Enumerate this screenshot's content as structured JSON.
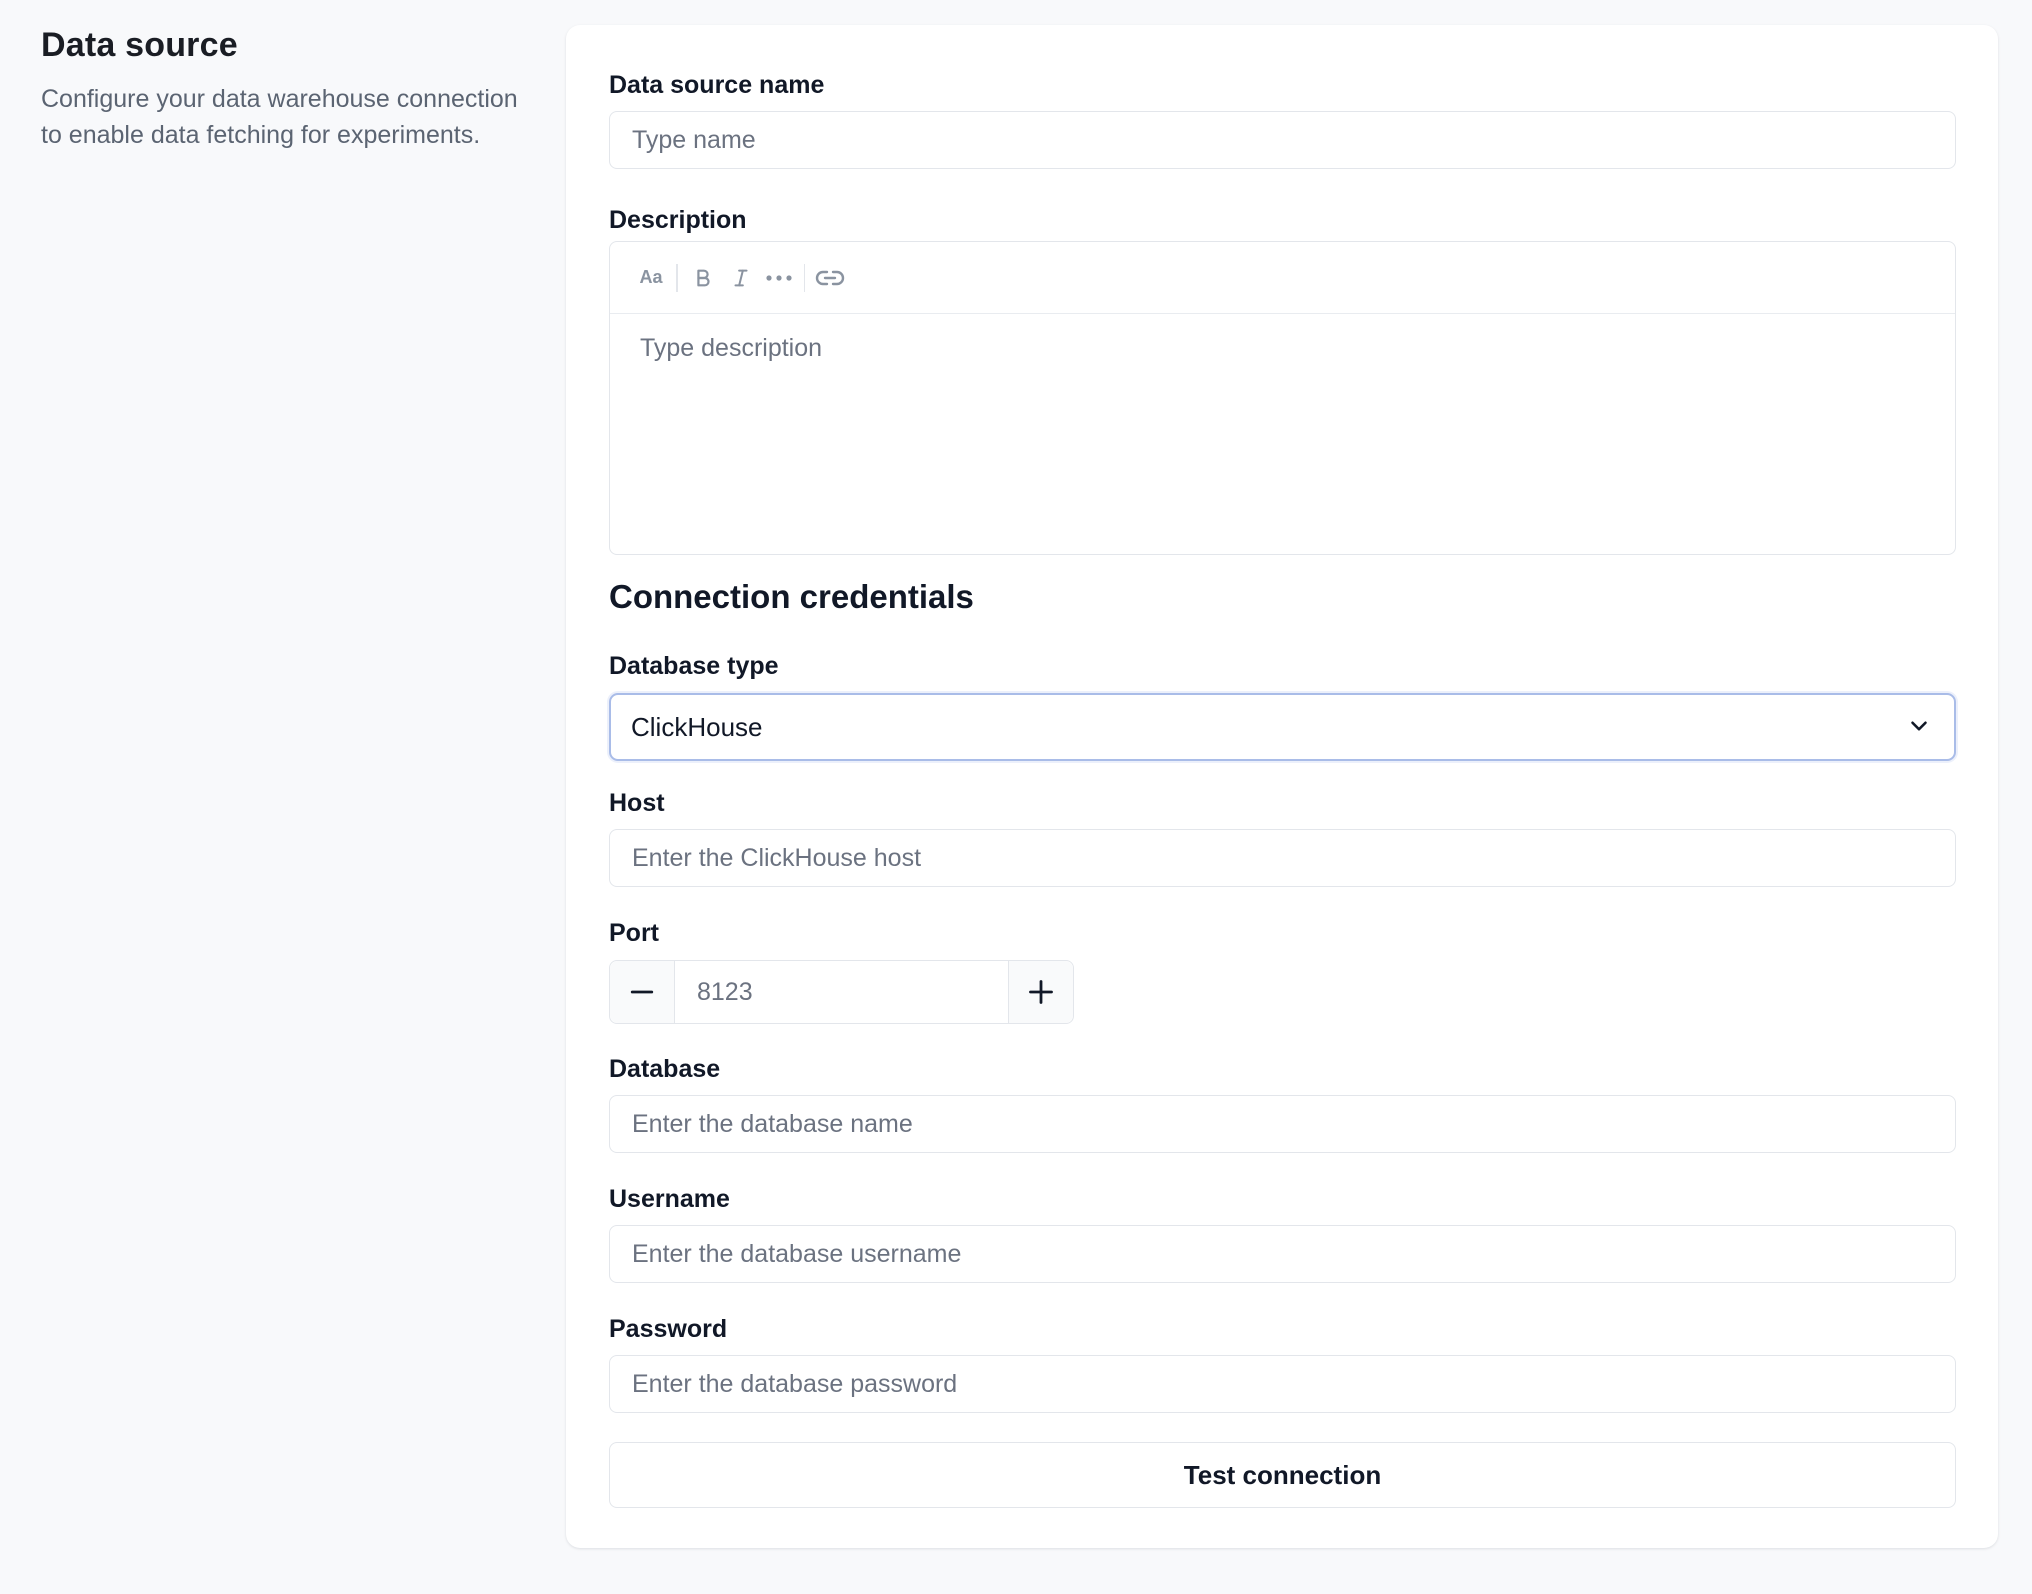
{
  "intro": {
    "title": "Data source",
    "description": "Configure your data warehouse connection to enable data fetching for experiments."
  },
  "form": {
    "name": {
      "label": "Data source name",
      "placeholder": "Type name"
    },
    "description": {
      "label": "Description",
      "placeholder": "Type description",
      "toolbar": {
        "text_style": "Aa",
        "icons": [
          "text-style-icon",
          "bold-icon",
          "italic-icon",
          "more-icon",
          "link-icon"
        ]
      }
    },
    "section_title": "Connection credentials",
    "database_type": {
      "label": "Database type",
      "value": "ClickHouse"
    },
    "host": {
      "label": "Host",
      "placeholder": "Enter the ClickHouse host"
    },
    "port": {
      "label": "Port",
      "value": "8123"
    },
    "database": {
      "label": "Database",
      "placeholder": "Enter the database name"
    },
    "username": {
      "label": "Username",
      "placeholder": "Enter the database username"
    },
    "password": {
      "label": "Password",
      "placeholder": "Enter the database password"
    },
    "test_button": "Test connection"
  },
  "colors": {
    "background": "#f8f9fb",
    "card": "#ffffff",
    "focus_border": "#a9bce8",
    "muted_text": "#6b7280"
  }
}
